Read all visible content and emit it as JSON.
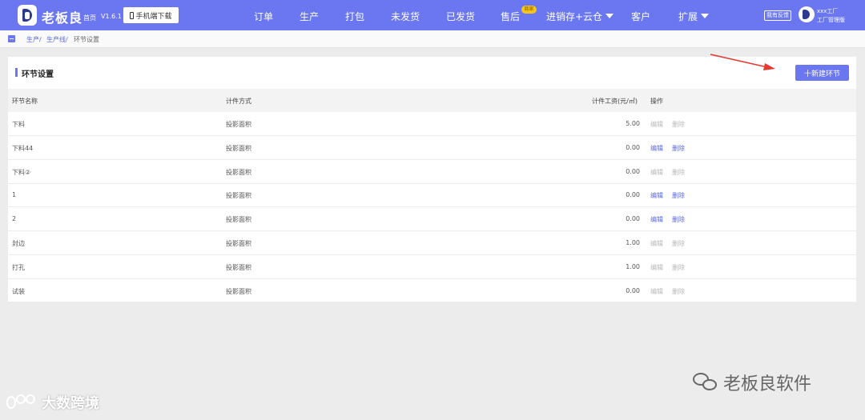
{
  "app": {
    "brand": "老板良",
    "home_label": "首页",
    "version": "V1.6.1",
    "mobile_download": "手机端下载"
  },
  "nav": {
    "items": [
      "订单",
      "生产",
      "打包",
      "未发货",
      "已发货",
      "售后",
      "进销存+云仓",
      "客户",
      "扩展"
    ],
    "badge": "商家",
    "dropdown_items": [
      "进销存+云仓",
      "扩展"
    ]
  },
  "header_right": {
    "feedback": "我有反馈",
    "factory_name": "xxx工厂",
    "role": "工厂管理版"
  },
  "breadcrumb": {
    "items": [
      "生产/",
      "生产线/",
      "环节设置"
    ]
  },
  "card": {
    "title": "环节设置",
    "new_button": "十新建环节"
  },
  "table": {
    "headers": [
      "环节名称",
      "计件方式",
      "计件工资(元/㎡)",
      "操作"
    ],
    "edit_label": "编辑",
    "delete_label": "删除",
    "rows": [
      {
        "name": "下料",
        "method": "投影面积",
        "wage": "5.00",
        "enabled": false
      },
      {
        "name": "下料44",
        "method": "投影面积",
        "wage": "0.00",
        "enabled": true
      },
      {
        "name": "下料②",
        "method": "投影面积",
        "wage": "0.00",
        "enabled": false
      },
      {
        "name": "1",
        "method": "投影面积",
        "wage": "0.00",
        "enabled": true
      },
      {
        "name": "2",
        "method": "投影面积",
        "wage": "0.00",
        "enabled": true
      },
      {
        "name": "封边",
        "method": "投影面积",
        "wage": "1.00",
        "enabled": false
      },
      {
        "name": "打孔",
        "method": "投影面积",
        "wage": "1.00",
        "enabled": false
      },
      {
        "name": "试装",
        "method": "投影面积",
        "wage": "0.00",
        "enabled": false
      }
    ]
  },
  "watermarks": {
    "right": "老板良软件",
    "left": "大数跨境"
  },
  "colors": {
    "primary": "#6a77f0",
    "link": "#5b6ae0",
    "disabled": "#b8b8b8",
    "annotation_arrow": "#e53935"
  }
}
